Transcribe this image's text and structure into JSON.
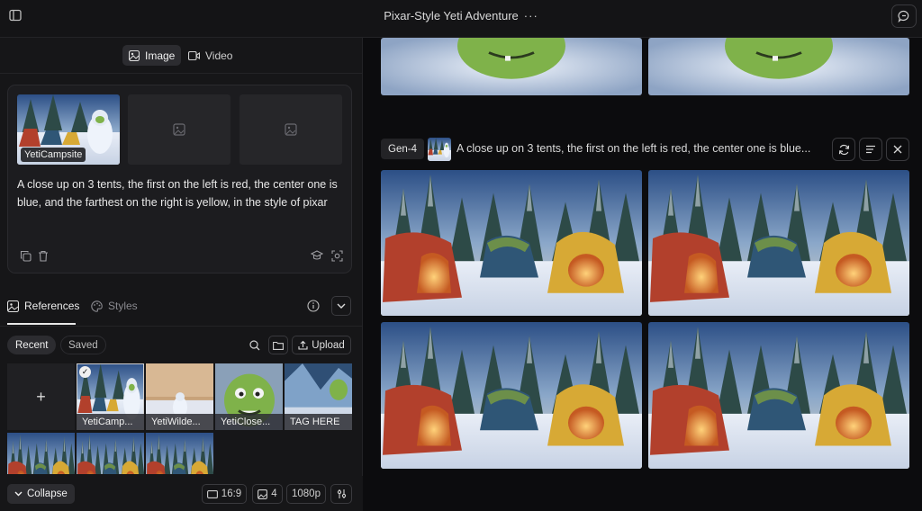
{
  "topbar": {
    "title": "Pixar-Style Yeti Adventure",
    "more": "···"
  },
  "mode_tabs": [
    {
      "label": "Image",
      "icon": "image-icon"
    },
    {
      "label": "Video",
      "icon": "video-icon"
    }
  ],
  "prompt_card": {
    "slots": [
      {
        "tag": "YetiCampsite"
      },
      {
        "tag": ""
      },
      {
        "tag": ""
      }
    ],
    "prompt": "A close up on 3 tents, the first on the left is red, the center one is blue, and the farthest on the right is yellow, in the style of pixar"
  },
  "ref_tabs": {
    "references": "References",
    "styles": "Styles"
  },
  "filters": {
    "recent": "Recent",
    "saved": "Saved",
    "upload": "Upload"
  },
  "tiles": [
    {
      "label": "YetiCamp..."
    },
    {
      "label": "YetiWilde..."
    },
    {
      "label": "YetiClose..."
    },
    {
      "label": "TAG HERE"
    }
  ],
  "add_tile": "+",
  "bottom": {
    "collapse": "Collapse",
    "aspect": "16:9",
    "count": "4",
    "resolution": "1080p"
  },
  "gen": {
    "model": "Gen-4",
    "prompt": "A close up on 3 tents, the first on the left is red, the center one is blue..."
  },
  "colors": {
    "tent_red": "#b2402c",
    "tent_blue": "#2f5676",
    "tent_yellow": "#d7a935",
    "snow": "#e9eef7",
    "yeti_green": "#7fb24a"
  }
}
